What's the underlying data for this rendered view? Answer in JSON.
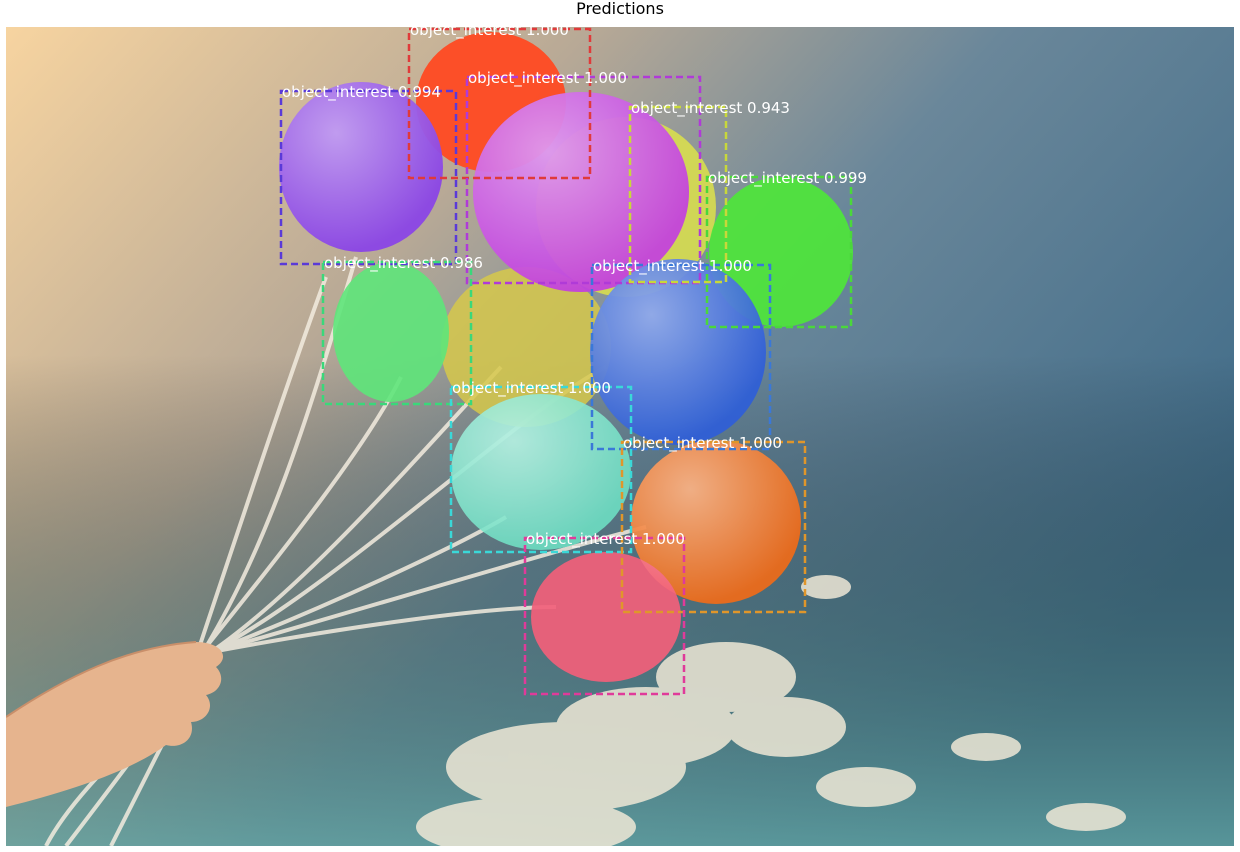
{
  "figure": {
    "title": "Predictions"
  },
  "detections": [
    {
      "label": "object_interest",
      "score": "1.000",
      "color": "#e03a3a"
    },
    {
      "label": "object_interest",
      "score": "1.000",
      "color": "#b03ad8"
    },
    {
      "label": "object_interest",
      "score": "0.994",
      "color": "#5a3ad8"
    },
    {
      "label": "object_interest",
      "score": "0.943",
      "color": "#c8d83a"
    },
    {
      "label": "object_interest",
      "score": "0.999",
      "color": "#4ad83a"
    },
    {
      "label": "object_interest",
      "score": "0.986",
      "color": "#3ad87a"
    },
    {
      "label": "object_interest",
      "score": "1.000",
      "color": "#3a78d8"
    },
    {
      "label": "object_interest",
      "score": "1.000",
      "color": "#3ad8d8"
    },
    {
      "label": "object_interest",
      "score": "1.000",
      "color": "#e0962a"
    },
    {
      "label": "object_interest",
      "score": "1.000",
      "color": "#e03a9a"
    }
  ]
}
